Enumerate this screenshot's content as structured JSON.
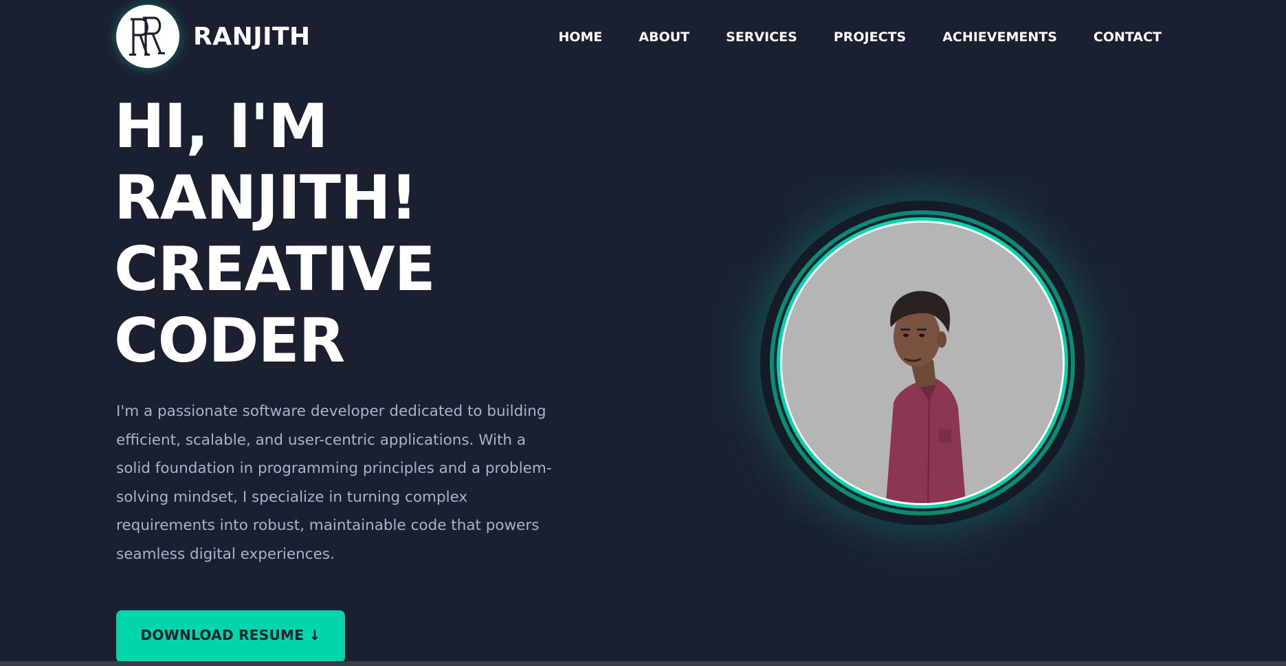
{
  "header": {
    "logo": {
      "monogram": "RR",
      "icon": "rr-monogram-logo"
    },
    "brand_name": "RANJITH",
    "nav": [
      {
        "label": "HOME"
      },
      {
        "label": "ABOUT"
      },
      {
        "label": "SERVICES"
      },
      {
        "label": "PROJECTS"
      },
      {
        "label": "ACHIEVEMENTS"
      },
      {
        "label": "CONTACT"
      }
    ]
  },
  "hero": {
    "title_lines": [
      "HI, I'M",
      "RANJITH!",
      "CREATIVE",
      "CODER"
    ],
    "description": "I'm a passionate software developer dedicated to building efficient, scalable, and user-centric applications. With a solid foundation in programming principles and a problem-solving mindset, I specialize in turning complex requirements into robust, maintainable code that powers seamless digital experiences.",
    "cta_label": "DOWNLOAD RESUME ↓"
  },
  "profile": {
    "icon": "profile-photo"
  },
  "colors": {
    "background": "#1b2030",
    "accent": "#00d4aa",
    "text_primary": "#ffffff",
    "text_secondary": "#a9b3cb"
  }
}
